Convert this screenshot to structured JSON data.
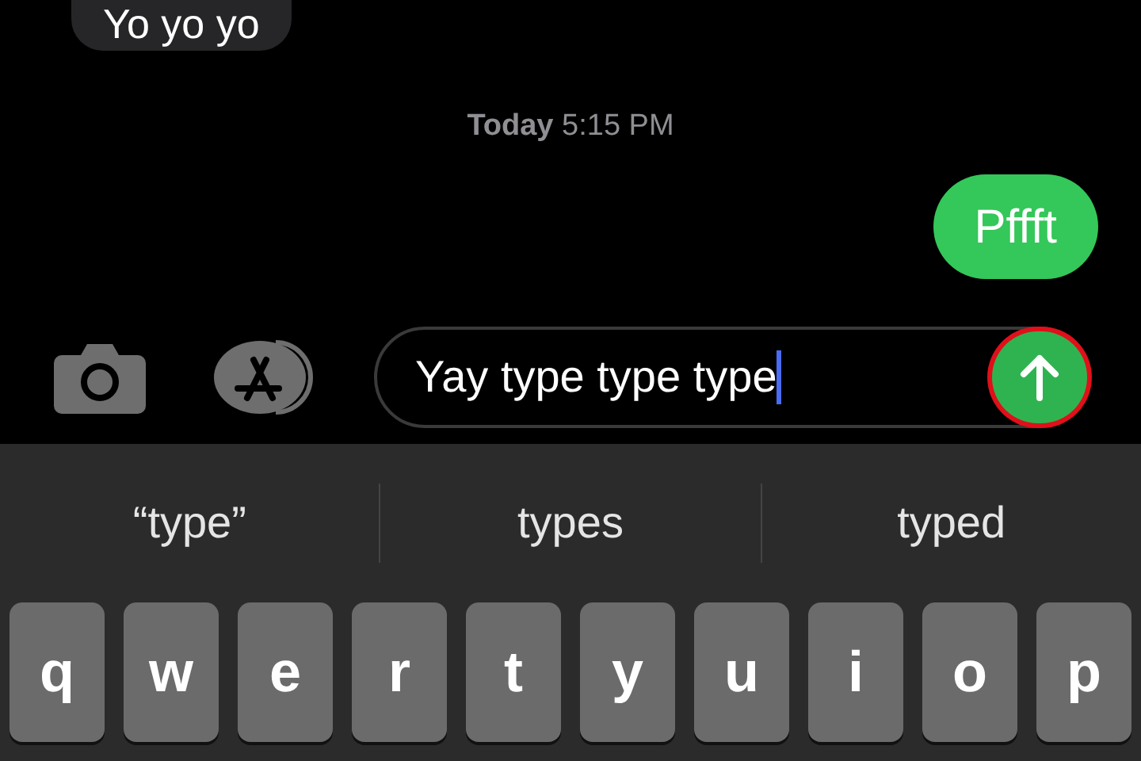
{
  "messages": [
    {
      "kind": "received",
      "text": "Yo yo yo"
    },
    {
      "kind": "timestamp",
      "text": "**Today** 5:15 PM"
    },
    {
      "kind": "sent",
      "text": "Pffft"
    }
  ],
  "composer": {
    "value": "Yay type type type",
    "send_highlighted": true
  },
  "suggestions": [
    "“type”",
    "types",
    "typed"
  ],
  "keys": [
    "q",
    "w",
    "e",
    "r",
    "t",
    "y",
    "u",
    "i",
    "o",
    "p"
  ]
}
